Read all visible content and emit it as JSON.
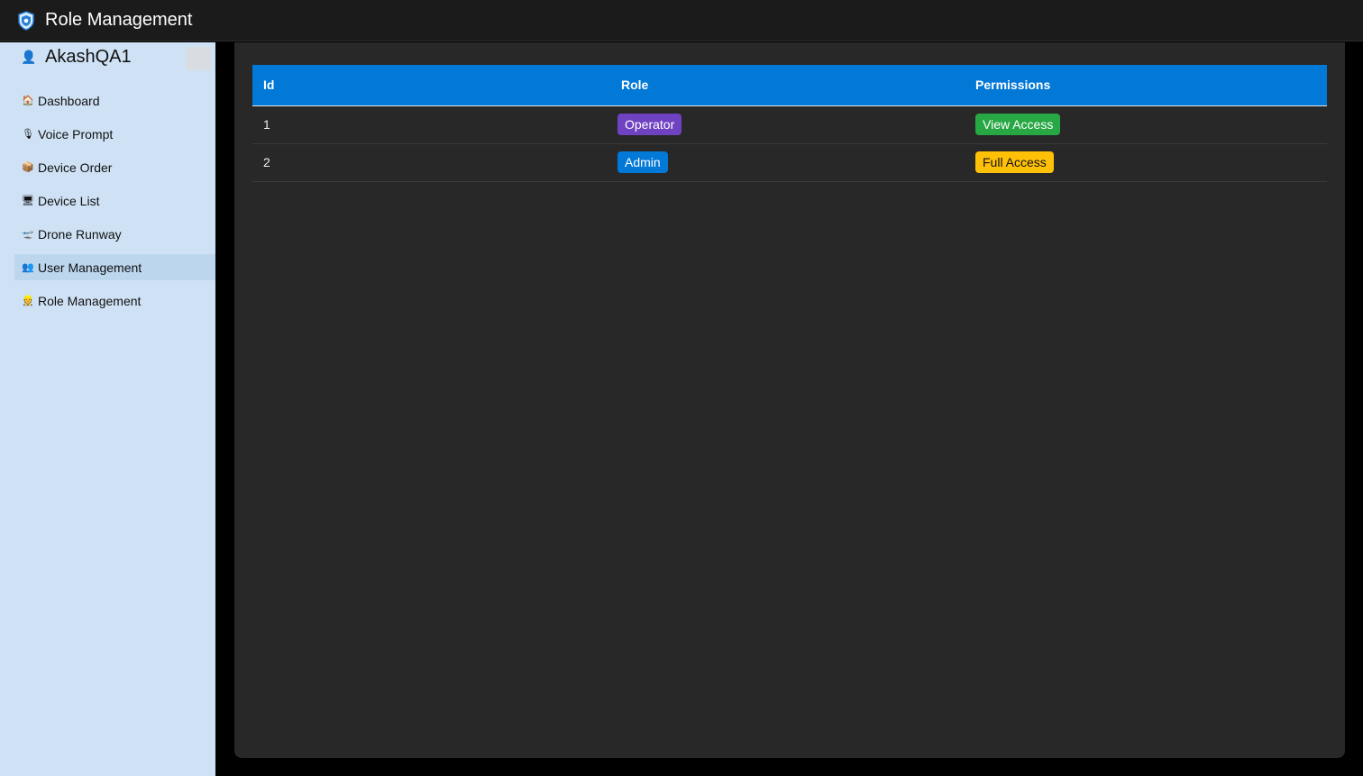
{
  "header": {
    "title": "Role Management",
    "logo_icon": "shield-icon"
  },
  "sidebar": {
    "user": {
      "name": "AkashQA1",
      "icon": "user-icon"
    },
    "items": [
      {
        "label": "Dashboard",
        "icon": "house-icon",
        "glyph": "🏠"
      },
      {
        "label": "Voice Prompt",
        "icon": "microphone-icon",
        "glyph": "🎙"
      },
      {
        "label": "Device Order",
        "icon": "package-icon",
        "glyph": "📦"
      },
      {
        "label": "Device List",
        "icon": "monitor-icon",
        "glyph": "🖥"
      },
      {
        "label": "Drone Runway",
        "icon": "airplane-icon",
        "glyph": "🛫"
      },
      {
        "label": "User Management",
        "icon": "users-icon",
        "glyph": "👥"
      },
      {
        "label": "Role Management",
        "icon": "worker-icon",
        "glyph": "👷"
      }
    ],
    "active_index": 5
  },
  "table": {
    "headers": [
      "Id",
      "Role",
      "Permissions"
    ],
    "rows": [
      {
        "id": "1",
        "role": "Operator",
        "role_color": "#6f42c1",
        "role_text_color": "#ffffff",
        "permission": "View Access",
        "permission_color": "#28a745",
        "permission_text_color": "#ffffff"
      },
      {
        "id": "2",
        "role": "Admin",
        "role_color": "#0278d7",
        "role_text_color": "#ffffff",
        "permission": "Full Access",
        "permission_color": "#ffc107",
        "permission_text_color": "#111111"
      }
    ]
  },
  "colors": {
    "header_bg": "#1b1b1b",
    "sidebar_bg": "#cfe2f5",
    "content_bg": "#282828",
    "table_header_bg": "#0278d7"
  }
}
